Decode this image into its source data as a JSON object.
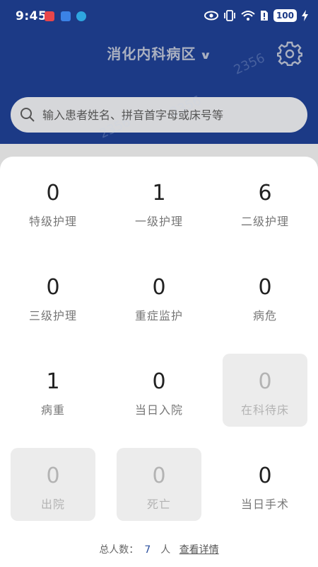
{
  "status_bar": {
    "time": "9:45",
    "battery": "100"
  },
  "header": {
    "title": "消化内科病区"
  },
  "search": {
    "placeholder": "输入患者姓名、拼音首字母或床号等"
  },
  "stats": [
    {
      "value": "0",
      "label": "特级护理",
      "disabled": false
    },
    {
      "value": "1",
      "label": "一级护理",
      "disabled": false
    },
    {
      "value": "6",
      "label": "二级护理",
      "disabled": false
    },
    {
      "value": "0",
      "label": "三级护理",
      "disabled": false
    },
    {
      "value": "0",
      "label": "重症监护",
      "disabled": false
    },
    {
      "value": "0",
      "label": "病危",
      "disabled": false
    },
    {
      "value": "1",
      "label": "病重",
      "disabled": false
    },
    {
      "value": "0",
      "label": "当日入院",
      "disabled": false
    },
    {
      "value": "0",
      "label": "在科待床",
      "disabled": true
    },
    {
      "value": "0",
      "label": "出院",
      "disabled": true
    },
    {
      "value": "0",
      "label": "死亡",
      "disabled": true
    },
    {
      "value": "0",
      "label": "当日手术",
      "disabled": false
    }
  ],
  "footer": {
    "total_label": "总人数：",
    "total": "7",
    "unit": "人",
    "details_link": "查看详情"
  },
  "watermark": "2356",
  "colors": {
    "header_bg": "#1c3a86",
    "accent": "#2b4f9e",
    "disabled_bg": "#ececec"
  }
}
